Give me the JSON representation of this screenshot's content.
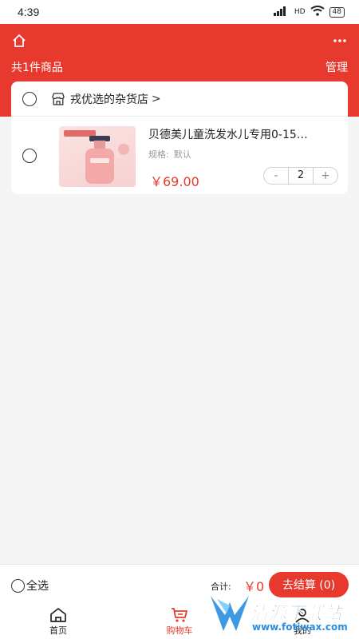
{
  "status_bar": {
    "time": "4:39",
    "network": "HD",
    "battery": "48"
  },
  "header": {
    "item_count": "共1件商品",
    "manage_label": "管理"
  },
  "cart": {
    "store_name": "戎优选的杂货店",
    "store_chevron": ">",
    "item": {
      "title": "贝德美儿童洗发水儿专用0-15…",
      "spec_label": "规格:",
      "spec_value": "默认",
      "price": "￥69.00",
      "quantity": "2",
      "minus": "-",
      "plus": "+"
    }
  },
  "checkout": {
    "select_all_label": "全选",
    "total_label": "合计:",
    "total_value": "￥0",
    "checkout_button": "去结算 (0)"
  },
  "tab_bar": {
    "tabs": [
      {
        "label": "首页",
        "icon": "home-icon",
        "active": false
      },
      {
        "label": "购物车",
        "icon": "cart-icon",
        "active": true
      },
      {
        "label": "我的",
        "icon": "user-icon",
        "active": false
      }
    ]
  },
  "watermark": {
    "title": "清源下载站",
    "url": "www.fotiwax.com"
  },
  "colors": {
    "accent": "#e8392f",
    "background": "#f4f4f4",
    "card": "#ffffff"
  }
}
